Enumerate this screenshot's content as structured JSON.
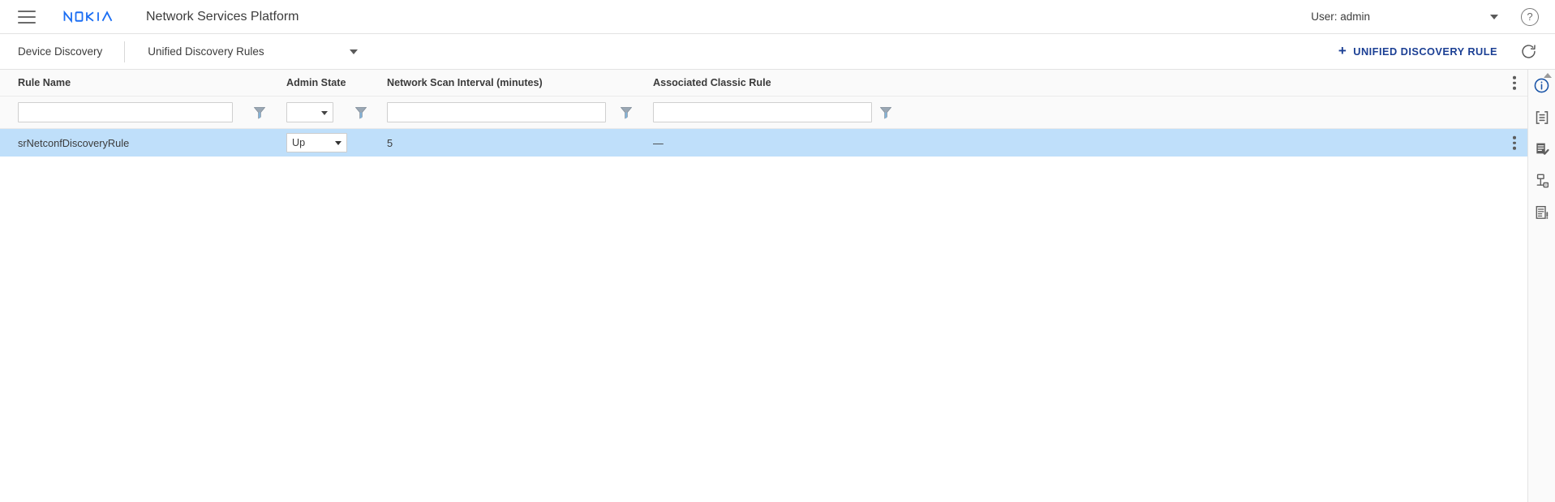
{
  "topbar": {
    "menu_icon": "hamburger-icon",
    "brand": "NOKIA",
    "app_title": "Network Services Platform",
    "user_label": "User: admin",
    "user_caret_icon": "chevron-down-icon",
    "help_icon": "help-circle-icon",
    "help_glyph": "?"
  },
  "subbar": {
    "breadcrumb_root": "Device Discovery",
    "breadcrumb_current": "Unified Discovery Rules",
    "breadcrumb_caret_icon": "chevron-down-icon",
    "add_button_plus": "+",
    "add_button_label": "UNIFIED DISCOVERY RULE",
    "refresh_icon": "refresh-icon"
  },
  "table": {
    "columns": [
      {
        "key": "rule_name",
        "label": "Rule Name"
      },
      {
        "key": "admin_state",
        "label": "Admin State"
      },
      {
        "key": "scan",
        "label": "Network Scan Interval (minutes)"
      },
      {
        "key": "assoc",
        "label": "Associated Classic Rule"
      }
    ],
    "filters": {
      "rule_name_value": "",
      "rule_name_placeholder": "",
      "admin_state_value": "",
      "scan_value": "",
      "scan_placeholder": "",
      "assoc_value": "",
      "assoc_placeholder": "",
      "funnel_icon": "filter-funnel-icon",
      "select_caret_icon": "chevron-down-icon"
    },
    "header_menu_icon": "kebab-menu-icon",
    "rows": [
      {
        "rule_name": "srNetconfDiscoveryRule",
        "admin_state": "Up",
        "scan": "5",
        "assoc": "—",
        "selected": true,
        "row_menu_icon": "kebab-menu-icon"
      }
    ]
  },
  "rail": {
    "scroll_up_icon": "scroll-up-arrow-icon",
    "items": [
      {
        "name": "info-icon",
        "title": "Information"
      },
      {
        "name": "properties-list-icon",
        "title": "Properties"
      },
      {
        "name": "task-checklist-icon",
        "title": "Tasks"
      },
      {
        "name": "network-topology-icon",
        "title": "Topology"
      },
      {
        "name": "alarm-log-icon",
        "title": "Alarms"
      }
    ]
  },
  "colors": {
    "brand_blue": "#1b6ef3",
    "action_blue": "#1b3f94",
    "row_selected": "#bfdffa",
    "header_bg": "#fafafa",
    "border": "#e2e2e2",
    "text": "#3b3b3b"
  }
}
